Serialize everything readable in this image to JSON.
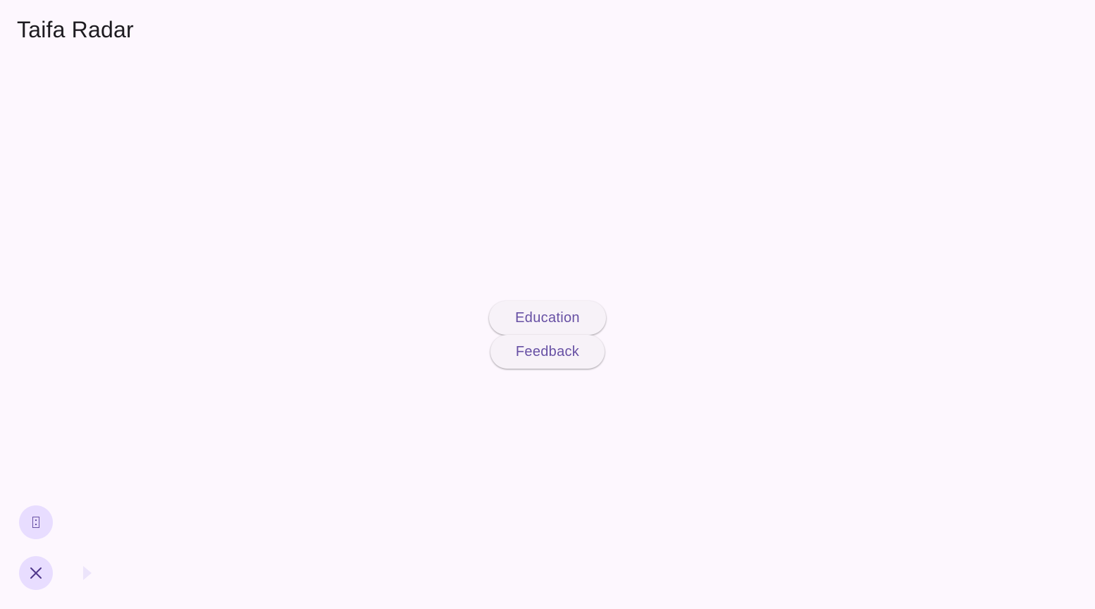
{
  "app": {
    "title": "Taifa Radar"
  },
  "menu": {
    "items": [
      {
        "label": "Education"
      },
      {
        "label": "Feedback"
      }
    ]
  },
  "fabs": {
    "top_icon": "missing-glyph-icon",
    "bottom_icon": "close-icon",
    "expand_icon": "play-arrow-icon"
  },
  "colors": {
    "background": "#fdf7fe",
    "accent": "#6750a4",
    "fab_background": "#e8ddff",
    "pill_background": "#f7f2f8",
    "title_text": "#1d1b20"
  }
}
